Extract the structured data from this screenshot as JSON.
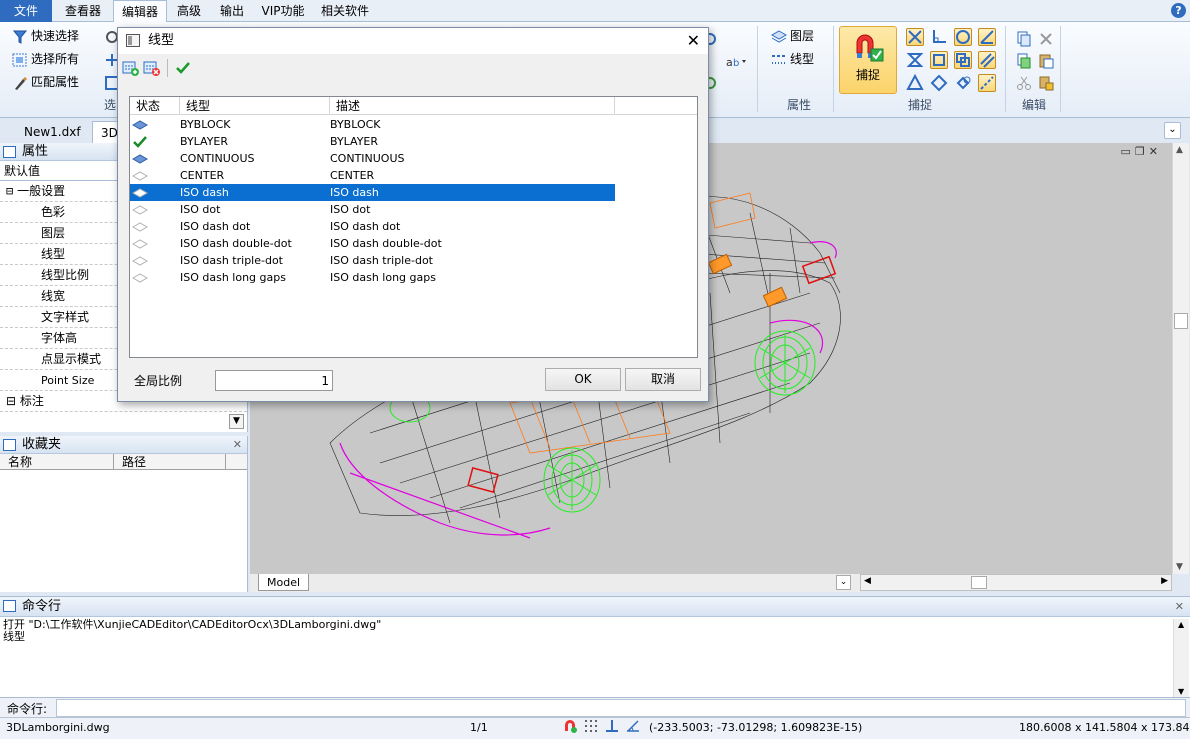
{
  "menu": {
    "tabs": [
      "文件",
      "查看器",
      "编辑器",
      "高级",
      "输出",
      "VIP功能",
      "相关软件"
    ],
    "active": "编辑器",
    "help": "?"
  },
  "ribbon": {
    "select_group": {
      "quick_select": "快速选择",
      "select_all": "选择所有",
      "match_props": "匹配属性",
      "label": "选"
    },
    "props_group": {
      "layer": "图层",
      "linetype": "线型",
      "label": "属性"
    },
    "snap_group": {
      "snap_button": "捕捉",
      "label": "捕捉"
    },
    "edit_group": {
      "label": "编辑"
    }
  },
  "doc_tabs": [
    "New1.dxf",
    "3D"
  ],
  "properties": {
    "title": "属性",
    "default_value": "默认值",
    "general_group": "一般设置",
    "rows": [
      "色彩",
      "图层",
      "线型",
      "线型比例",
      "线宽",
      "文字样式",
      "字体高",
      "点显示模式",
      "Point Size"
    ],
    "dim_group": "标注"
  },
  "favorites": {
    "title": "收藏夹",
    "col_name": "名称",
    "col_path": "路径"
  },
  "model_tab": "Model",
  "command": {
    "title": "命令行",
    "history": [
      "打开 \"D:\\工作软件\\XunjieCADEditor\\CADEditorOcx\\3DLamborgini.dwg\"",
      "线型"
    ],
    "prompt": "命令行:",
    "input_value": ""
  },
  "status": {
    "file": "3DLamborgini.dwg",
    "page": "1/1",
    "coords": "(-233.5003; -73.01298; 1.609823E-15)",
    "dims": "180.6008 x 141.5804 x 173.8424"
  },
  "dialog": {
    "title": "线型",
    "columns": [
      "状态",
      "线型",
      "描述"
    ],
    "rows": [
      {
        "name": "BYBLOCK",
        "desc": "BYBLOCK",
        "state": "diamond-icon"
      },
      {
        "name": "BYLAYER",
        "desc": "BYLAYER",
        "state": "check-icon"
      },
      {
        "name": "CONTINUOUS",
        "desc": "CONTINUOUS",
        "state": "diamond-icon"
      },
      {
        "name": "CENTER",
        "desc": "CENTER",
        "state": "diamond-empty-icon"
      },
      {
        "name": "ISO dash",
        "desc": "ISO dash",
        "state": "diamond-empty-icon",
        "selected": true
      },
      {
        "name": "ISO dot",
        "desc": "ISO dot",
        "state": "diamond-empty-icon"
      },
      {
        "name": "ISO dash dot",
        "desc": "ISO dash dot",
        "state": "diamond-empty-icon"
      },
      {
        "name": "ISO dash double-dot",
        "desc": "ISO dash double-dot",
        "state": "diamond-empty-icon"
      },
      {
        "name": "ISO dash triple-dot",
        "desc": "ISO dash triple-dot",
        "state": "diamond-empty-icon"
      },
      {
        "name": "ISO dash long gaps",
        "desc": "ISO dash long gaps",
        "state": "diamond-empty-icon"
      }
    ],
    "global_scale_label": "全局比例",
    "global_scale_value": "1",
    "ok": "OK",
    "cancel": "取消"
  },
  "colors": {
    "accent": "#2f6cc0",
    "selection": "#0a6fd0",
    "wire": "#202020",
    "wheel": "#22ee22",
    "trim": "#e000e0",
    "accent_orange": "#ff8c1a"
  }
}
